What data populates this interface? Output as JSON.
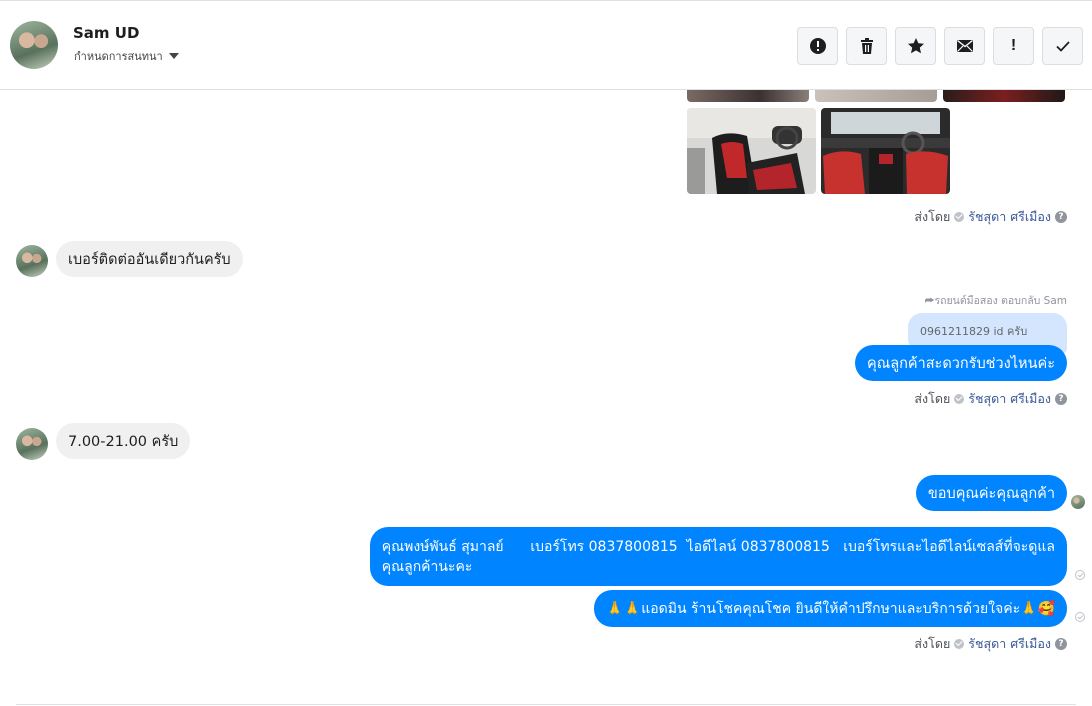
{
  "header": {
    "name": "Sam UD",
    "subtitle": "กำหนดการสนทนา",
    "tools": [
      {
        "icon": "alert-circle-icon"
      },
      {
        "icon": "trash-icon"
      },
      {
        "icon": "star-icon"
      },
      {
        "icon": "envelope-icon"
      },
      {
        "icon": "exclamation-icon",
        "label": "!"
      },
      {
        "icon": "check-icon"
      }
    ]
  },
  "conversation": {
    "sent_by_prefix": "ส่งโดย",
    "sender_name": "รัชสุดา ศรีเมือง",
    "messages": [
      {
        "dir": "in",
        "text": "เบอร์ติดต่ออันเดียวกันครับ"
      },
      {
        "dir": "out",
        "reply_hint": "รถยนต์มือสอง ตอบกลับ Sam",
        "quoted": "0961211829 id ครับ",
        "text": "คุณลูกค้าสะดวกรับช่วงไหนค่ะ"
      },
      {
        "dir": "in",
        "text": "7.00-21.00 ครับ"
      },
      {
        "dir": "out",
        "text": "ขอบคุณค่ะคุณลูกค้า"
      },
      {
        "dir": "out",
        "line1": "คุณพงษ์พันธ์ สุมาลย์      เบอร์โทร 0837800815  ไอดีไลน์ 0837800815   เบอร์โทรและไอดีไลน์เซลส์ที่จะดูแล",
        "line2": "คุณลูกค้านะคะ"
      },
      {
        "dir": "out",
        "text": "🙏🙏แอดมิน ร้านโชคคุณโชค ยินดีให้คำปรึกษาและบริการด้วยใจค่ะ🙏🥰"
      }
    ]
  },
  "colors": {
    "outgoing_bubble": "#0084ff",
    "incoming_bubble": "#f0f0f0",
    "link": "#385898"
  }
}
